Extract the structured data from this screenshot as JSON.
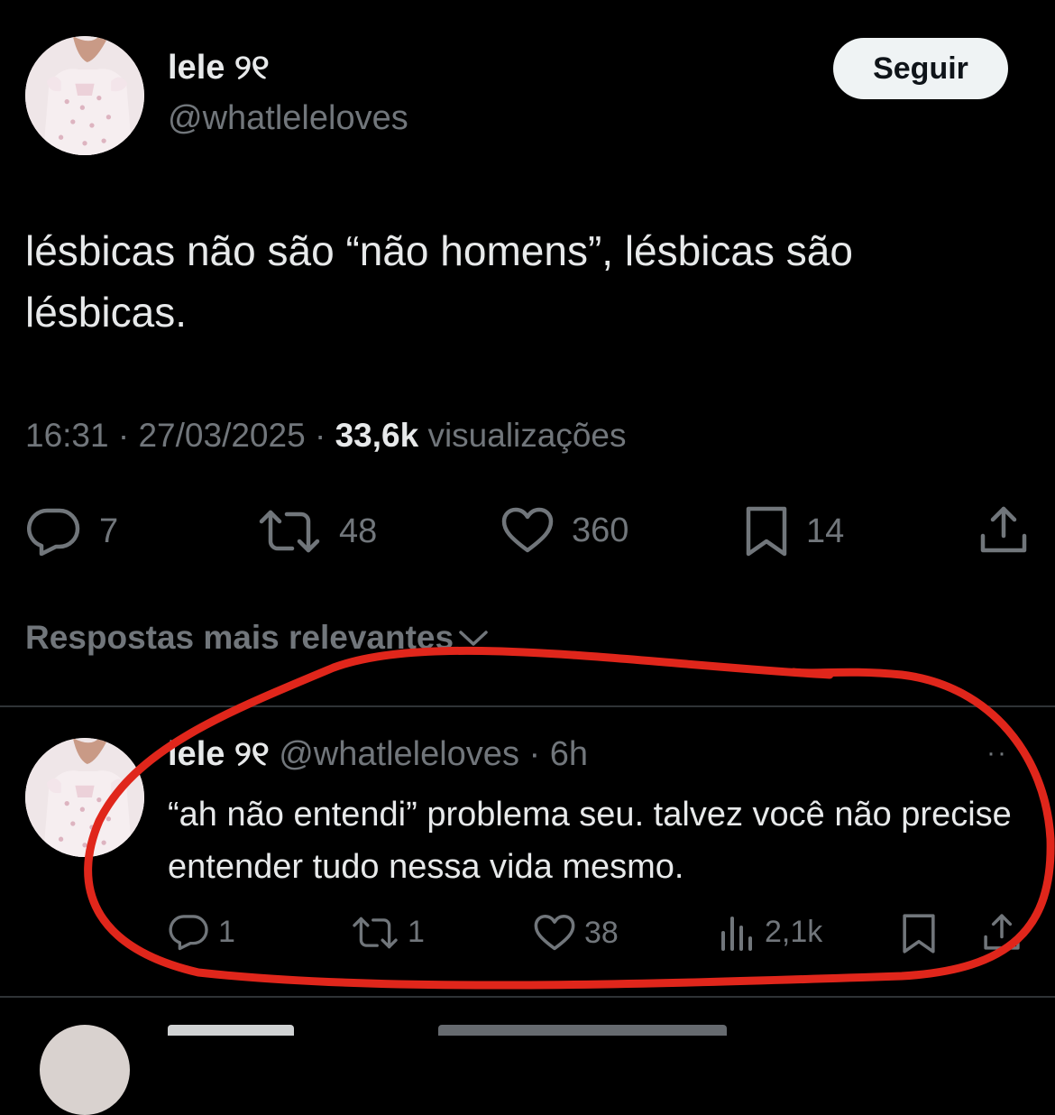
{
  "tweet": {
    "author": {
      "display_name": "lele ୨୧",
      "handle": "@whatleleloves",
      "avatar_icon": "avatar-girl-pink-dress"
    },
    "follow_label": "Seguir",
    "text": "lésbicas não são “não homens”, lésbicas são lésbicas.",
    "time": "16:31",
    "date": "27/03/2025",
    "separator": "·",
    "views_count": "33,6k",
    "views_label": "visualizações",
    "actions": {
      "replies": "7",
      "retweets": "48",
      "likes": "360",
      "bookmarks": "14"
    }
  },
  "sort": {
    "label": "Respostas mais relevantes"
  },
  "reply": {
    "display_name": "lele ୨୧",
    "handle": "@whatleleloves",
    "time_ago": "6h",
    "separator": "·",
    "text": "“ah não entendi” problema seu. talvez você não precise entender tudo nessa vida mesmo.",
    "more": "··",
    "actions": {
      "replies": "1",
      "retweets": "1",
      "likes": "38",
      "views": "2,1k"
    }
  },
  "colors": {
    "background": "#000000",
    "primary_text": "#e7e9ea",
    "secondary_text": "#71767b",
    "divider": "#2f3336",
    "annotation_red": "#e0261b"
  }
}
